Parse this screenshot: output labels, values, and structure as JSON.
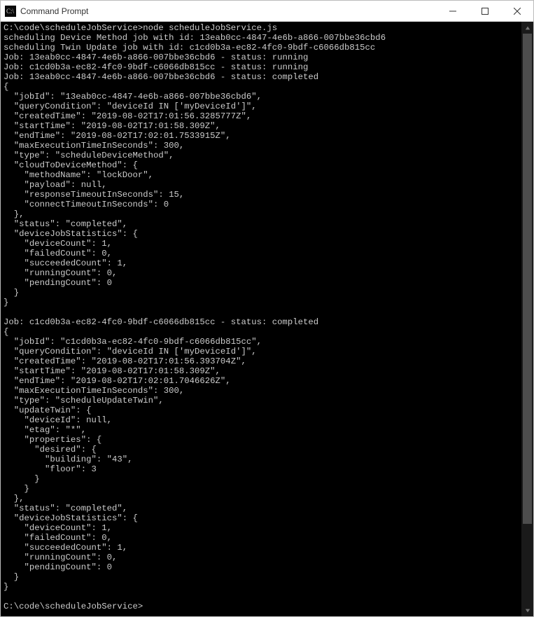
{
  "window": {
    "title": "Command Prompt"
  },
  "console": {
    "prompt1_path": "C:\\code\\scheduleJobService>",
    "prompt1_cmd": "node scheduleJobService.js",
    "scheduling_line1": "scheduling Device Method job with id: 13eab0cc-4847-4e6b-a866-007bbe36cbd6",
    "scheduling_line2": "scheduling Twin Update job with id: c1cd0b3a-ec82-4fc0-9bdf-c6066db815cc",
    "status_line1": "Job: 13eab0cc-4847-4e6b-a866-007bbe36cbd6 - status: running",
    "status_line2": "Job: c1cd0b3a-ec82-4fc0-9bdf-c6066db815cc - status: running",
    "status_line3": "Job: 13eab0cc-4847-4e6b-a866-007bbe36cbd6 - status: completed",
    "job1_json": "{\n  \"jobId\": \"13eab0cc-4847-4e6b-a866-007bbe36cbd6\",\n  \"queryCondition\": \"deviceId IN ['myDeviceId']\",\n  \"createdTime\": \"2019-08-02T17:01:56.3285777Z\",\n  \"startTime\": \"2019-08-02T17:01:58.309Z\",\n  \"endTime\": \"2019-08-02T17:02:01.7533915Z\",\n  \"maxExecutionTimeInSeconds\": 300,\n  \"type\": \"scheduleDeviceMethod\",\n  \"cloudToDeviceMethod\": {\n    \"methodName\": \"lockDoor\",\n    \"payload\": null,\n    \"responseTimeoutInSeconds\": 15,\n    \"connectTimeoutInSeconds\": 0\n  },\n  \"status\": \"completed\",\n  \"deviceJobStatistics\": {\n    \"deviceCount\": 1,\n    \"failedCount\": 0,\n    \"succeededCount\": 1,\n    \"runningCount\": 0,\n    \"pendingCount\": 0\n  }\n}",
    "status_line4": "Job: c1cd0b3a-ec82-4fc0-9bdf-c6066db815cc - status: completed",
    "job2_json": "{\n  \"jobId\": \"c1cd0b3a-ec82-4fc0-9bdf-c6066db815cc\",\n  \"queryCondition\": \"deviceId IN ['myDeviceId']\",\n  \"createdTime\": \"2019-08-02T17:01:56.393704Z\",\n  \"startTime\": \"2019-08-02T17:01:58.309Z\",\n  \"endTime\": \"2019-08-02T17:02:01.7046626Z\",\n  \"maxExecutionTimeInSeconds\": 300,\n  \"type\": \"scheduleUpdateTwin\",\n  \"updateTwin\": {\n    \"deviceId\": null,\n    \"etag\": \"*\",\n    \"properties\": {\n      \"desired\": {\n        \"building\": \"43\",\n        \"floor\": 3\n      }\n    }\n  },\n  \"status\": \"completed\",\n  \"deviceJobStatistics\": {\n    \"deviceCount\": 1,\n    \"failedCount\": 0,\n    \"succeededCount\": 1,\n    \"runningCount\": 0,\n    \"pendingCount\": 0\n  }\n}",
    "prompt2": "C:\\code\\scheduleJobService>"
  }
}
